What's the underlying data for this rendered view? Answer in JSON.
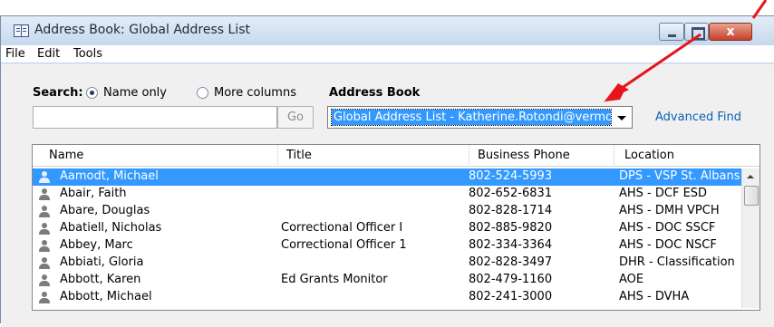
{
  "window": {
    "title": "Address Book: Global Address List",
    "close_glyph": "x"
  },
  "menu": {
    "file": "File",
    "edit": "Edit",
    "tools": "Tools"
  },
  "search": {
    "label": "Search:",
    "option_name_only": "Name only",
    "option_more_columns": "More columns",
    "selected_option": "Name only",
    "input_value": "",
    "go_label": "Go"
  },
  "address_book": {
    "label": "Address Book",
    "selected_value": "Global Address List - Katherine.Rotondi@vermont.gov",
    "advanced_find": "Advanced Find"
  },
  "list": {
    "columns": [
      "Name",
      "Title",
      "Business Phone",
      "Location"
    ],
    "rows": [
      {
        "name": "Aamodt, Michael",
        "title": "",
        "phone": "802-524-5993",
        "location": "DPS - VSP St. Albans"
      },
      {
        "name": "Abair, Faith",
        "title": "",
        "phone": "802-652-6831",
        "location": "AHS - DCF ESD"
      },
      {
        "name": "Abare, Douglas",
        "title": "",
        "phone": "802-828-1714",
        "location": "AHS - DMH VPCH"
      },
      {
        "name": "Abatiell, Nicholas",
        "title": "Correctional Officer I",
        "phone": "802-885-9820",
        "location": "AHS - DOC SSCF"
      },
      {
        "name": "Abbey, Marc",
        "title": "Correctional Officer 1",
        "phone": "802-334-3364",
        "location": "AHS - DOC NSCF"
      },
      {
        "name": "Abbiati, Gloria",
        "title": "",
        "phone": "802-828-3497",
        "location": "DHR - Classification"
      },
      {
        "name": "Abbott, Karen",
        "title": "Ed Grants Monitor",
        "phone": "802-479-1160",
        "location": "AOE"
      },
      {
        "name": "Abbott, Michael",
        "title": "",
        "phone": "802-241-3000",
        "location": "AHS - DVHA"
      }
    ],
    "selected_index": 0
  },
  "colors": {
    "selection": "#3399ff",
    "link": "#0d5fb6",
    "annotation_arrow": "#e8141b"
  },
  "icons": [
    "person-icon",
    "address-book-icon",
    "minimize-icon",
    "maximize-icon",
    "close-icon",
    "dropdown-arrow-icon"
  ]
}
